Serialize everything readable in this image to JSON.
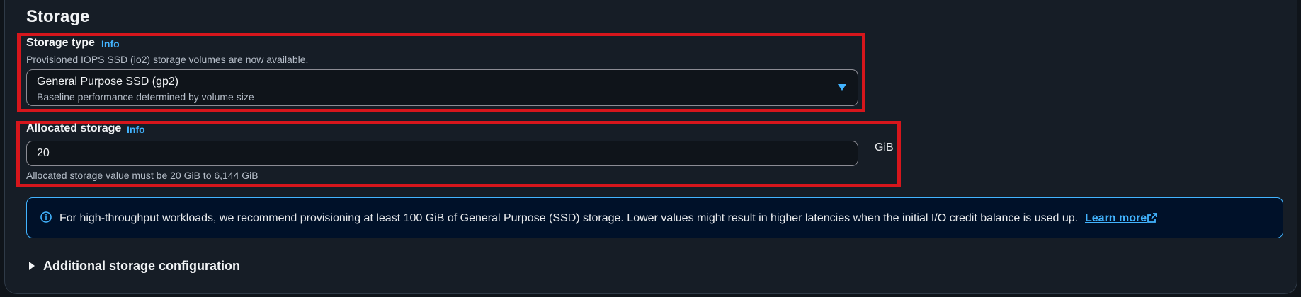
{
  "section": {
    "title": "Storage"
  },
  "storage_type": {
    "label": "Storage type",
    "info": "Info",
    "hint": "Provisioned IOPS SSD (io2) storage volumes are now available.",
    "selected_main": "General Purpose SSD (gp2)",
    "selected_sub": "Baseline performance determined by volume size"
  },
  "allocated_storage": {
    "label": "Allocated storage",
    "info": "Info",
    "value": "20",
    "unit": "GiB",
    "constraint": "Allocated storage value must be 20 GiB to 6,144 GiB"
  },
  "alert": {
    "text": "For high-throughput workloads, we recommend provisioning at least 100 GiB of General Purpose (SSD) storage. Lower values might result in higher latencies when the initial I/O credit balance is used up.",
    "link": "Learn more"
  },
  "additional": {
    "label": "Additional storage configuration"
  },
  "colors": {
    "accent": "#42b4ff",
    "highlight_border": "#d6161c",
    "background": "#161d26"
  },
  "icons": {
    "caret": "chevron-down-icon",
    "info": "info-circle-icon",
    "external": "external-link-icon",
    "expand": "caret-right-icon"
  }
}
